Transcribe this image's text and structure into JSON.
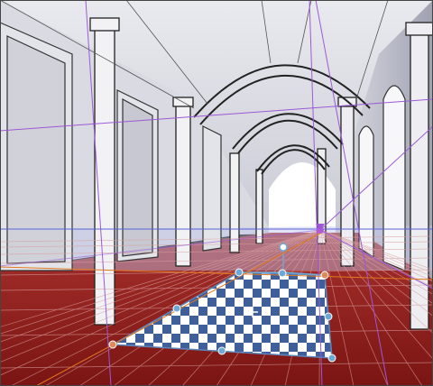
{
  "canvas": {
    "content": "corridor-perspective-scene"
  },
  "colors": {
    "wall": "#d8d9e0",
    "wall_shadow": "#b9bbc8",
    "ceiling": "#c8c9d3",
    "floor": "#8c1f1c",
    "floor_light": "#b4433d",
    "sky": "#ffffff",
    "perspective_line": "#9d59d6",
    "horizon_line": "#5a63d8",
    "orange_guide": "#e2781f",
    "handle_blue": "#6ea8d6",
    "handle_orange": "#e08a5a",
    "checker_dark": "#3f5f9a",
    "checker_light": "#ffffff"
  },
  "tool": {
    "name": "perspective-transform",
    "handles": [
      "top-left",
      "top-mid",
      "top-right",
      "right-mid",
      "bottom-right",
      "bottom-mid",
      "bottom-left",
      "left-mid",
      "pivot-top",
      "center-cross"
    ]
  }
}
